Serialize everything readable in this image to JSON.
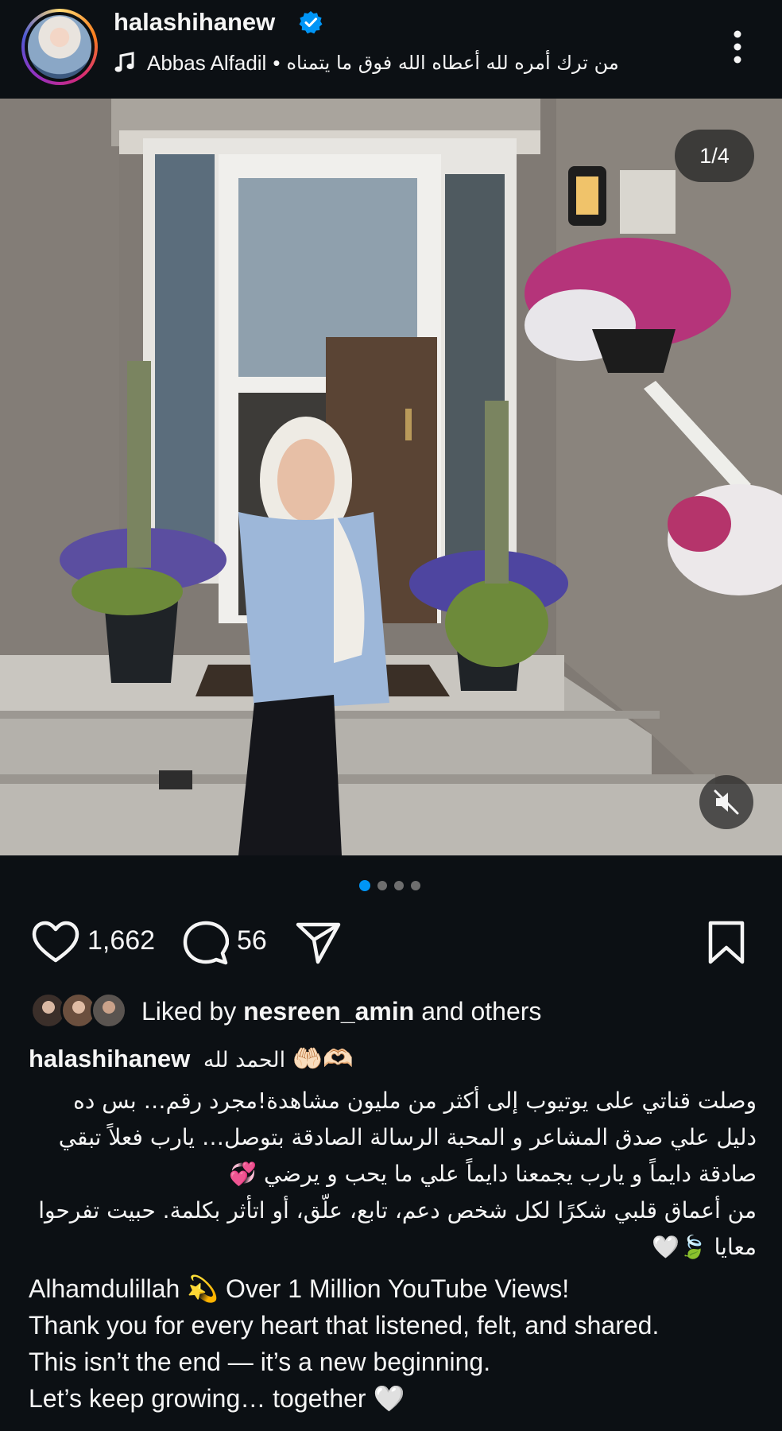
{
  "header": {
    "username": "halashihanew",
    "music_artist": "Abbas Alfadil",
    "music_separator": "•",
    "music_title": "من ترك أمره لله أعطاه الله فوق ما يتمناه",
    "icons": [
      "verified-badge-icon",
      "music-note-icon",
      "more-options-icon"
    ]
  },
  "media": {
    "counter": "1/4",
    "mute_icon": "muted-speaker-icon",
    "carousel_count": 4,
    "carousel_active": 1
  },
  "actions": {
    "likes": "1,662",
    "comments": "56",
    "icons": [
      "heart-icon",
      "comment-icon",
      "share-icon",
      "bookmark-icon"
    ]
  },
  "liked_by": {
    "prefix": "Liked by",
    "user": "nesreen_amin",
    "suffix": "and others"
  },
  "caption": {
    "username": "halashihanew",
    "headline_ar": "الحمد لله",
    "headline_emoji": "🤲🏻🫶🏻",
    "arabic_paragraph_1": "وصلت قناتي على يوتيوب إلى أكثر من مليون مشاهدة!مجرد رقم… بس ده دليل علي صدق المشاعر و المحبة الرسالة الصادقة بتوصل… يارب فعلاً تبقي صادقة دايماً و يارب يجمعنا دايماً علي ما يحب و يرضي 💞",
    "arabic_paragraph_2": "من أعماق قلبي شكرًا لكل شخص دعم، تابع، علّق، أو اتأثر بكلمة. حبيت تفرحوا معايا 🍃🤍",
    "english_lines": [
      "Alhamdulillah 💫 Over 1 Million YouTube Views!",
      "Thank you for every heart that listened, felt, and shared.",
      "This isn’t the end — it’s a new beginning.",
      "Let’s keep growing… together 🤍"
    ]
  },
  "colors": {
    "background": "#0c1014",
    "text": "#f5f5f5",
    "accent_blue": "#0095f6",
    "verified_blue": "#0095f6"
  }
}
